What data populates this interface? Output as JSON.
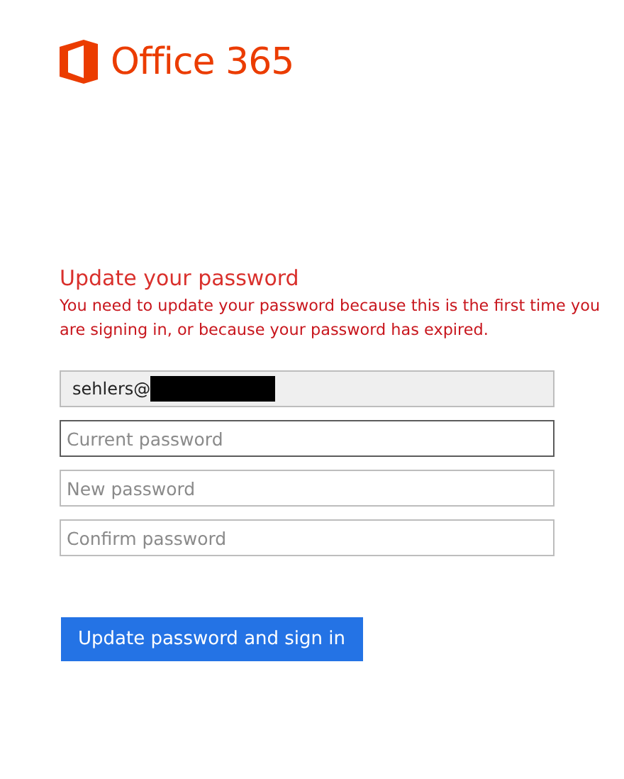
{
  "brand": {
    "name": "Office 365"
  },
  "heading": "Update your password",
  "message": "You need to update your password because this is the first time you are signing in, or because your password has expired.",
  "fields": [
    {
      "kind": "readonly",
      "value": "sehlers@",
      "redacted": true,
      "focused": false
    },
    {
      "kind": "password",
      "placeholder": "Current password",
      "focused": true
    },
    {
      "kind": "password",
      "placeholder": "New password",
      "focused": false
    },
    {
      "kind": "password",
      "placeholder": "Confirm password",
      "focused": false
    }
  ],
  "submit": {
    "label": "Update password and sign in"
  }
}
